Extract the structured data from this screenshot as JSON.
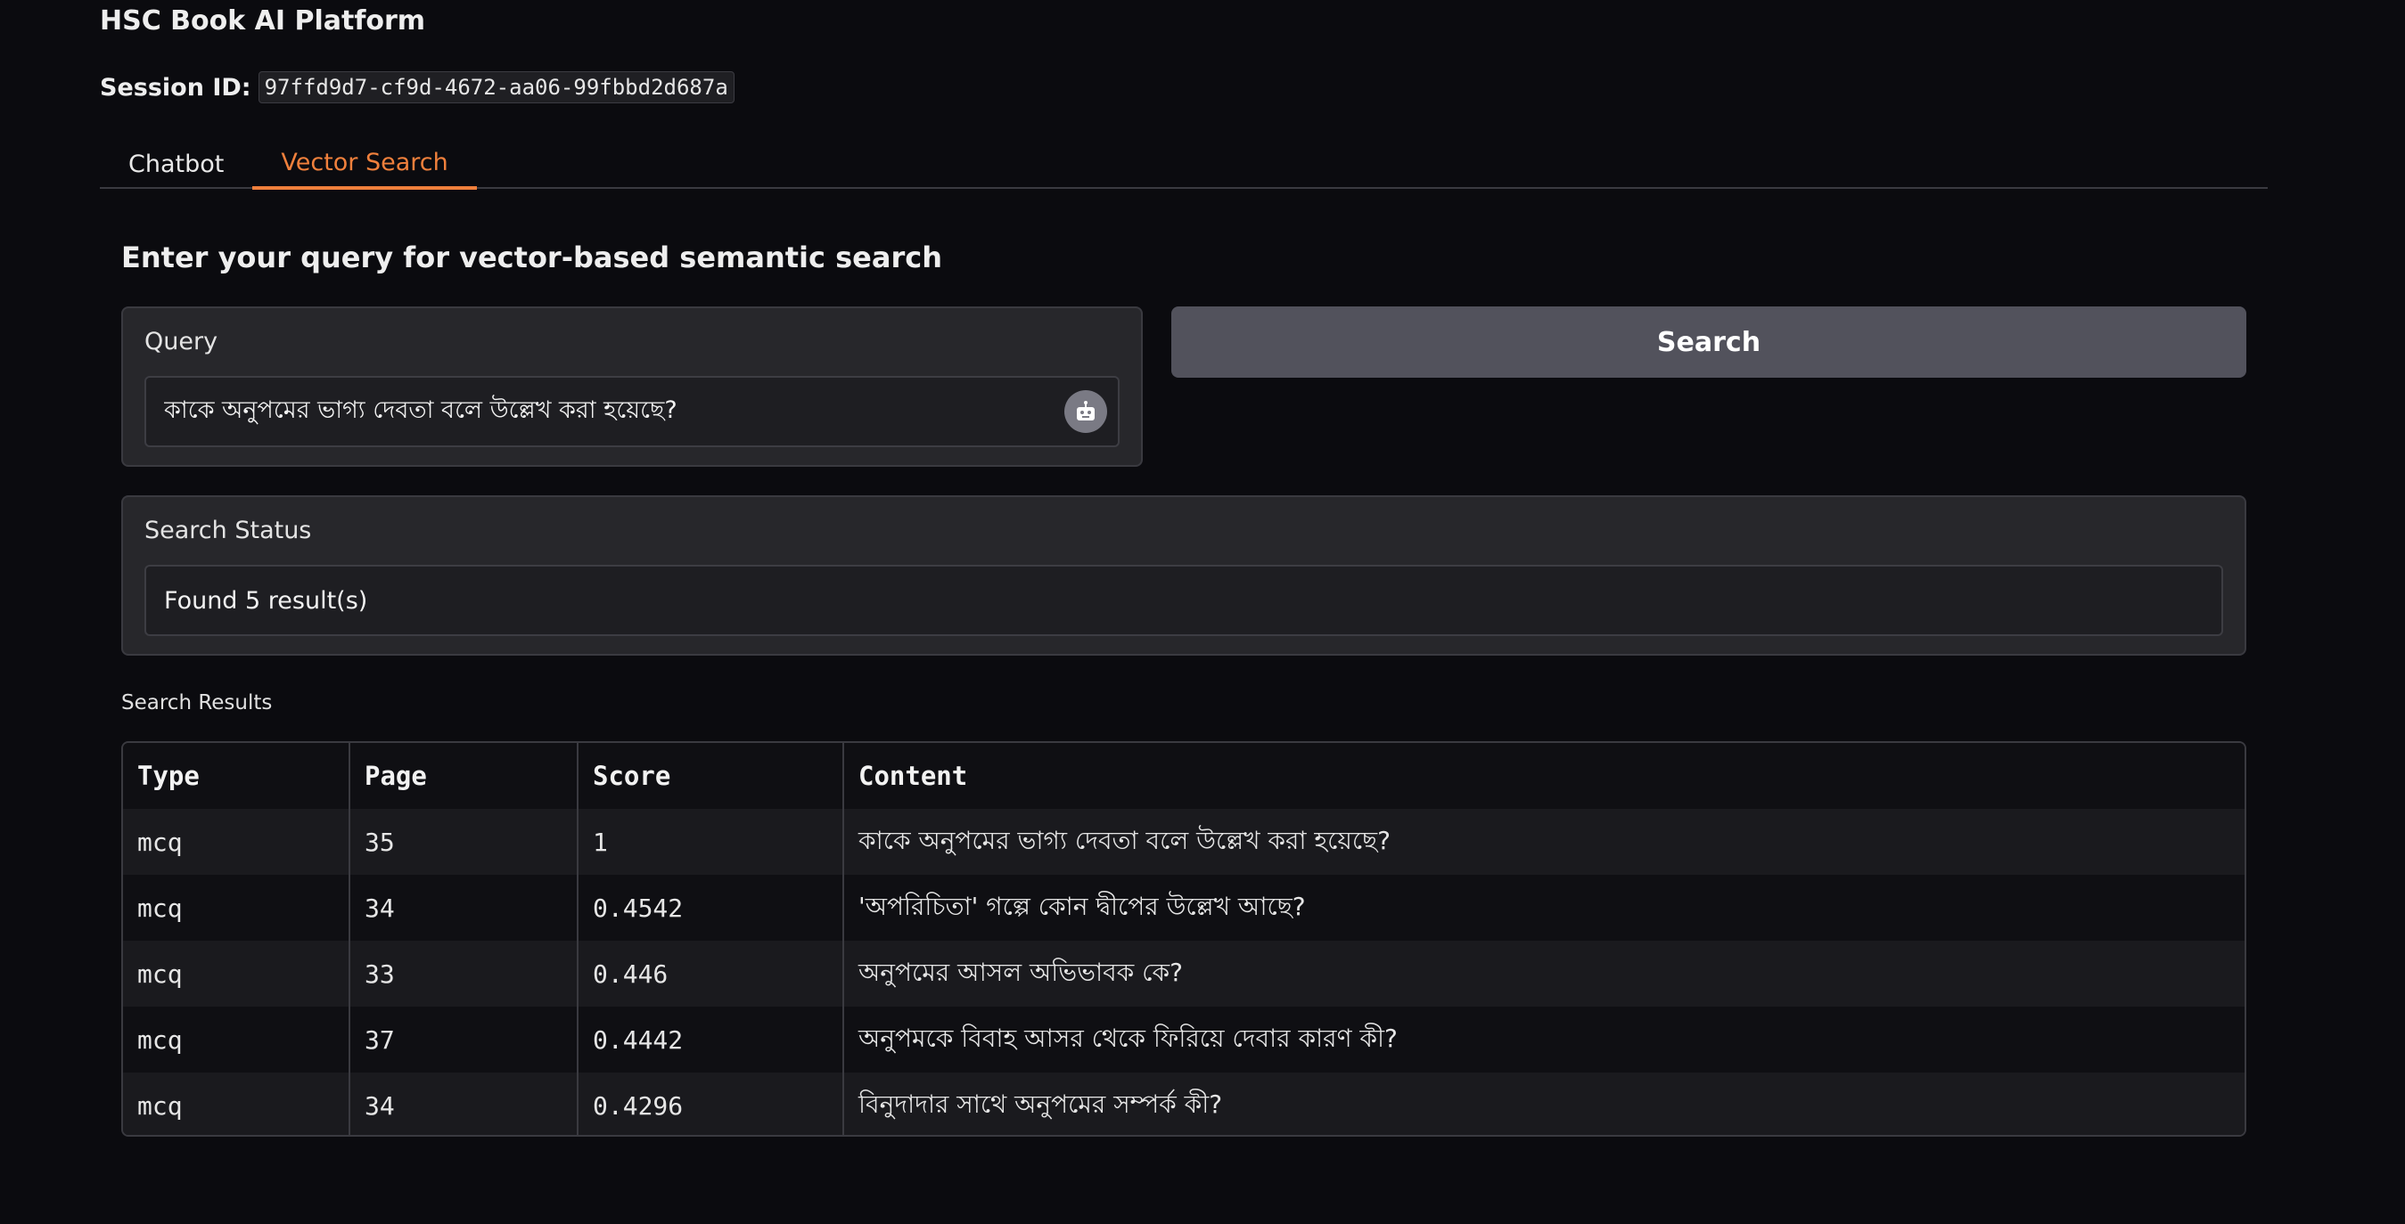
{
  "app": {
    "title": "HSC Book AI Platform"
  },
  "session": {
    "label": "Session ID:",
    "id": "97ffd9d7-cf9d-4672-aa06-99fbbd2d687a"
  },
  "tabs": [
    {
      "label": "Chatbot",
      "active": false
    },
    {
      "label": "Vector Search",
      "active": true
    }
  ],
  "search": {
    "heading": "Enter your query for vector-based semantic search",
    "query_label": "Query",
    "query_value": "কাকে অনুপমের ভাগ্য দেবতা বলে উল্লেখ করা হয়েছে?",
    "button_label": "Search",
    "robot_icon": "robot-icon"
  },
  "status": {
    "label": "Search Status",
    "value": "Found 5 result(s)"
  },
  "results": {
    "label": "Search Results",
    "columns": [
      "Type",
      "Page",
      "Score",
      "Content"
    ],
    "rows": [
      {
        "type": "mcq",
        "page": "35",
        "score": "1",
        "content": "কাকে অনুপমের ভাগ্য দেবতা বলে উল্লেখ করা হয়েছে?"
      },
      {
        "type": "mcq",
        "page": "34",
        "score": "0.4542",
        "content": "'অপরিচিতা' গল্পে কোন দ্বীপের উল্লেখ আছে?"
      },
      {
        "type": "mcq",
        "page": "33",
        "score": "0.446",
        "content": "অনুপমের আসল অভিভাবক কে?"
      },
      {
        "type": "mcq",
        "page": "37",
        "score": "0.4442",
        "content": "অনুপমকে বিবাহ আসর থেকে ফিরিয়ে দেবার কারণ কী?"
      },
      {
        "type": "mcq",
        "page": "34",
        "score": "0.4296",
        "content": "বিনুদাদার সাথে অনুপমের সম্পর্ক কী?"
      }
    ]
  },
  "colors": {
    "accent": "#f0803c",
    "background": "#0b0b0f",
    "panel": "#27272b",
    "button": "#52525c"
  }
}
